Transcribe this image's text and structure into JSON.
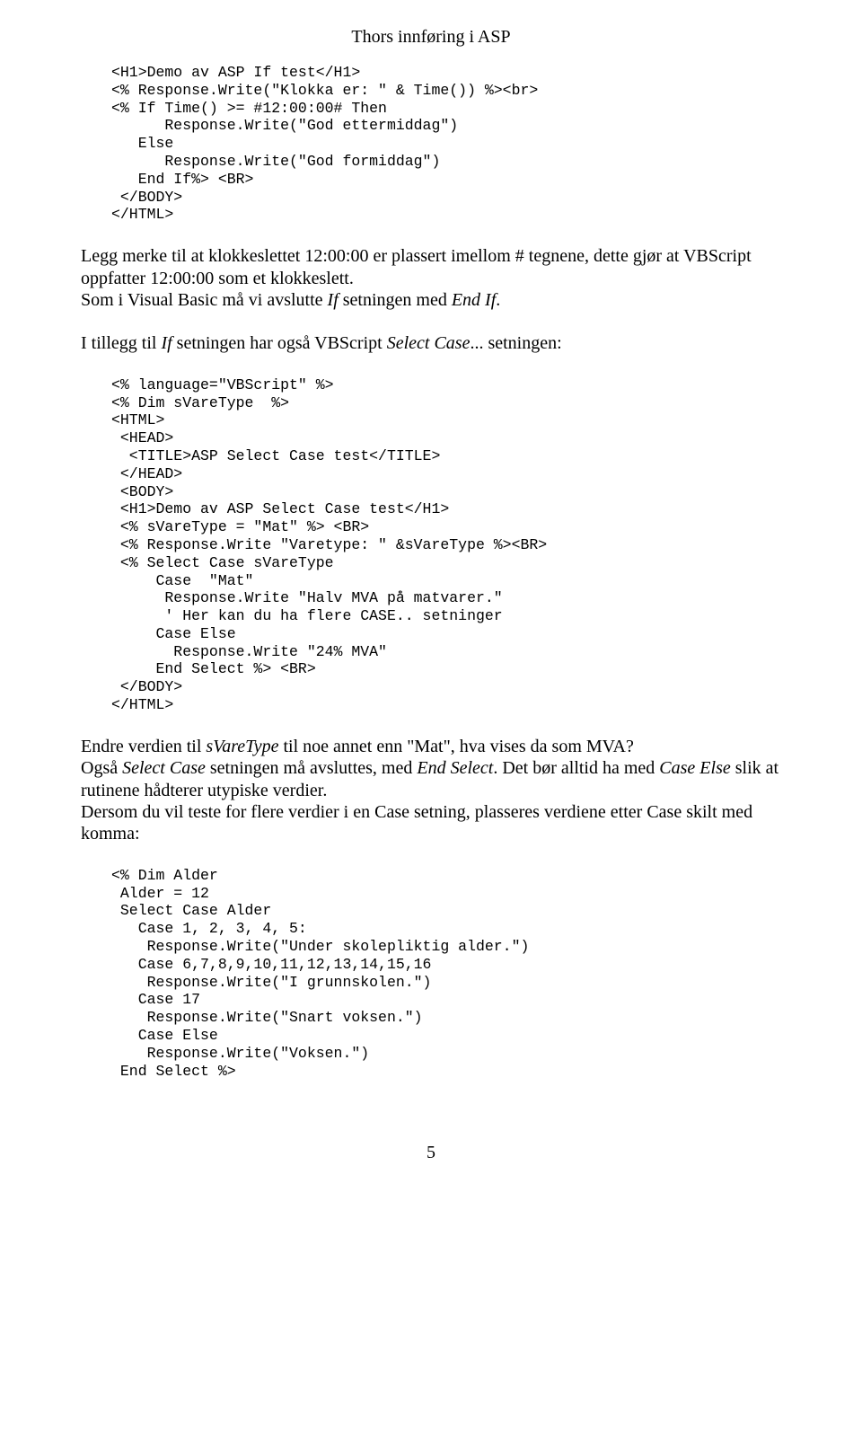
{
  "header": "Thors innføring i ASP",
  "code1": "<H1>Demo av ASP If test</H1>\n<% Response.Write(\"Klokka er: \" & Time()) %><br>\n<% If Time() >= #12:00:00# Then\n      Response.Write(\"God ettermiddag\")\n   Else\n      Response.Write(\"God formiddag\")\n   End If%> <BR>\n </BODY>\n</HTML>",
  "p1a": "  Legg merke til at klokkeslettet 12:00:00 er plassert imellom # tegnene, dette gjør at VBScript oppfatter 12:00:00 som et klokkeslett.",
  "p1b_pre": "  Som i Visual Basic må vi avslutte ",
  "p1b_if": "If",
  "p1b_mid": " setningen med ",
  "p1b_end": "End If",
  "p1b_post": ".",
  "p2_pre": "  I tillegg til ",
  "p2_if": "If",
  "p2_mid": " setningen har også VBScript ",
  "p2_sc": "Select Case",
  "p2_post": "... setningen:",
  "code2": "<% language=\"VBScript\" %>\n<% Dim sVareType  %>\n<HTML>\n <HEAD>\n  <TITLE>ASP Select Case test</TITLE>\n </HEAD>\n <BODY>\n <H1>Demo av ASP Select Case test</H1>\n <% sVareType = \"Mat\" %> <BR>\n <% Response.Write \"Varetype: \" &sVareType %><BR>\n <% Select Case sVareType\n     Case  \"Mat\"\n      Response.Write \"Halv MVA på matvarer.\"\n      ' Her kan du ha flere CASE.. setninger\n     Case Else\n       Response.Write \"24% MVA\"\n     End Select %> <BR>\n </BODY>\n</HTML>",
  "p3_pre": "  Endre verdien til ",
  "p3_svt": "sVareType",
  "p3_post": " til noe annet enn \"Mat\", hva vises da som MVA?",
  "p4_pre": "  Også ",
  "p4_sc": "Select Case",
  "p4_mid": " setningen må avsluttes, med ",
  "p4_es": "End Select",
  "p4_mid2": ". Det bør alltid ha med ",
  "p4_ce": "Case Else",
  "p4_post": " slik at rutinene hådterer utypiske verdier.",
  "p5": "  Dersom du vil teste for flere verdier i en Case setning, plasseres verdiene etter Case skilt med komma:",
  "code3": "<% Dim Alder\n Alder = 12\n Select Case Alder\n   Case 1, 2, 3, 4, 5:\n    Response.Write(\"Under skolepliktig alder.\")\n   Case 6,7,8,9,10,11,12,13,14,15,16\n    Response.Write(\"I grunnskolen.\")\n   Case 17\n    Response.Write(\"Snart voksen.\")\n   Case Else\n    Response.Write(\"Voksen.\")\n End Select %>",
  "pageNumber": "5"
}
